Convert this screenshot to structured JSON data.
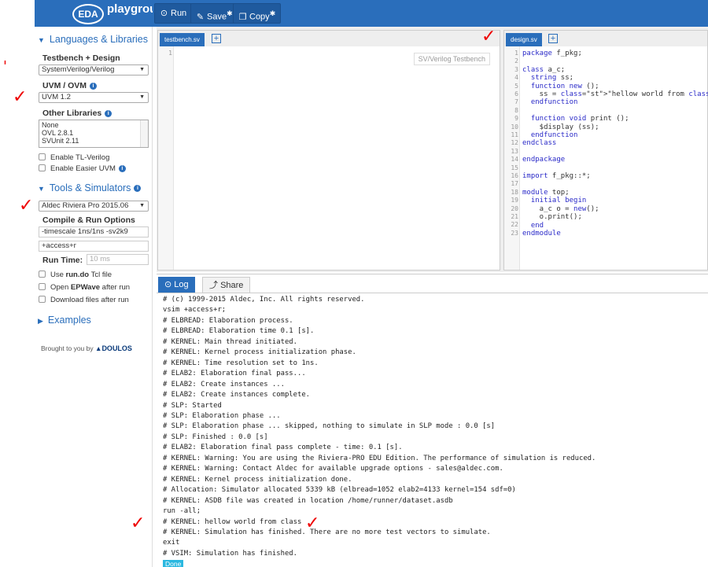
{
  "app": {
    "logo_mark": "EDA",
    "logo_text": "playground"
  },
  "toolbar": {
    "run": "Run",
    "save": "Save",
    "copy": "Copy",
    "star": "✱"
  },
  "sidebar": {
    "languages_header": "Languages & Libraries",
    "testbench_label": "Testbench + Design",
    "testbench_value": "SystemVerilog/Verilog",
    "uvm_label": "UVM / OVM",
    "uvm_value": "UVM 1.2",
    "other_libs_label": "Other Libraries",
    "other_libs": [
      "None",
      "OVL 2.8.1",
      "SVUnit 2.11"
    ],
    "enable_tl": "Enable TL-Verilog",
    "enable_easier_uvm": "Enable Easier UVM",
    "tools_header": "Tools & Simulators",
    "simulator_value": "Aldec Riviera Pro 2015.06",
    "compile_label": "Compile & Run Options",
    "compile_opts": "-timescale 1ns/1ns -sv2k9",
    "run_opts": "+access+r",
    "run_time_label": "Run Time:",
    "run_time_placeholder": "10 ms",
    "use_rundo_a": "Use ",
    "use_rundo_b": "run.do",
    "use_rundo_c": " Tcl file",
    "open_epwave_a": "Open ",
    "open_epwave_b": "EPWave",
    "open_epwave_c": " after run",
    "download_files": "Download files after run",
    "examples_header": "Examples",
    "brought_by": "Brought to you by",
    "doulos": "DOULOS"
  },
  "editors": {
    "left_tab": "testbench.sv",
    "left_hint": "SV/Verilog Testbench",
    "right_tab": "design.sv",
    "design_lines": [
      "package f_pkg;",
      "",
      "class a_c;",
      "  string ss;",
      "  function new ();",
      "    ss = \"hellow world from class\";",
      "  endfunction",
      "",
      "  function void print ();",
      "    $display (ss);",
      "  endfunction",
      "endclass",
      "",
      "endpackage",
      "",
      "import f_pkg::*;",
      "",
      "module top;",
      "  initial begin",
      "    a_c o = new();",
      "    o.print();",
      "  end",
      "endmodule"
    ]
  },
  "log": {
    "log_tab": "Log",
    "share_tab": "Share",
    "lines": [
      "# (c) 1999-2015 Aldec, Inc. All rights reserved.",
      "vsim +access+r;",
      "# ELBREAD: Elaboration process.",
      "# ELBREAD: Elaboration time 0.1 [s].",
      "# KERNEL: Main thread initiated.",
      "# KERNEL: Kernel process initialization phase.",
      "# KERNEL: Time resolution set to 1ns.",
      "# ELAB2: Elaboration final pass...",
      "# ELAB2: Create instances ...",
      "# ELAB2: Create instances complete.",
      "# SLP: Started",
      "# SLP: Elaboration phase ...",
      "# SLP: Elaboration phase ... skipped, nothing to simulate in SLP mode : 0.0 [s]",
      "# SLP: Finished : 0.0 [s]",
      "# ELAB2: Elaboration final pass complete - time: 0.1 [s].",
      "# KERNEL: Warning: You are using the Riviera-PRO EDU Edition. The performance of simulation is reduced.",
      "# KERNEL: Warning: Contact Aldec for available upgrade options - sales@aldec.com.",
      "# KERNEL: Kernel process initialization done.",
      "# Allocation: Simulator allocated 5339 kB (elbread=1052 elab2=4133 kernel=154 sdf=0)",
      "# KERNEL: ASDB file was created in location /home/runner/dataset.asdb",
      "run -all;",
      "# KERNEL: hellow world from class",
      "# KERNEL: Simulation has finished. There are no more test vectors to simulate.",
      "exit",
      "# VSIM: Simulation has finished."
    ],
    "done_badge": "Done"
  },
  "annotations": {
    "check": "✓",
    "tick": "'"
  },
  "colors": {
    "brand_blue": "#2a6ebb",
    "annotation_red": "#e00000"
  }
}
